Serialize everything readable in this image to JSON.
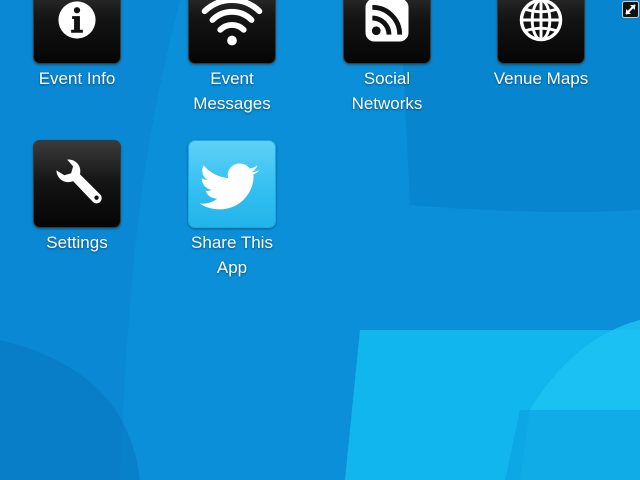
{
  "colors": {
    "background": "#0a8fd8",
    "tile_dark": "#141414",
    "tile_twitter": "#33c0f1",
    "badge": "#d9262b",
    "label": "#ffffff"
  },
  "apps": [
    {
      "id": "event-info",
      "label_lines": [
        "Event Info"
      ],
      "icon": "info-icon"
    },
    {
      "id": "event-messages",
      "label_lines": [
        "Event",
        "Messages"
      ],
      "icon": "wifi-icon",
      "badge": "close-badge-icon"
    },
    {
      "id": "social-networks",
      "label_lines": [
        "Social",
        "Networks"
      ],
      "icon": "rss-icon"
    },
    {
      "id": "venue-maps",
      "label_lines": [
        "Venue Maps"
      ],
      "icon": "globe-icon"
    },
    {
      "id": "settings",
      "label_lines": [
        "Settings"
      ],
      "icon": "wrench-icon"
    },
    {
      "id": "share-this-app",
      "label_lines": [
        "Share This",
        "App"
      ],
      "icon": "twitter-bird-icon"
    }
  ],
  "system": {
    "resize_icon": "expand-arrow-icon"
  }
}
